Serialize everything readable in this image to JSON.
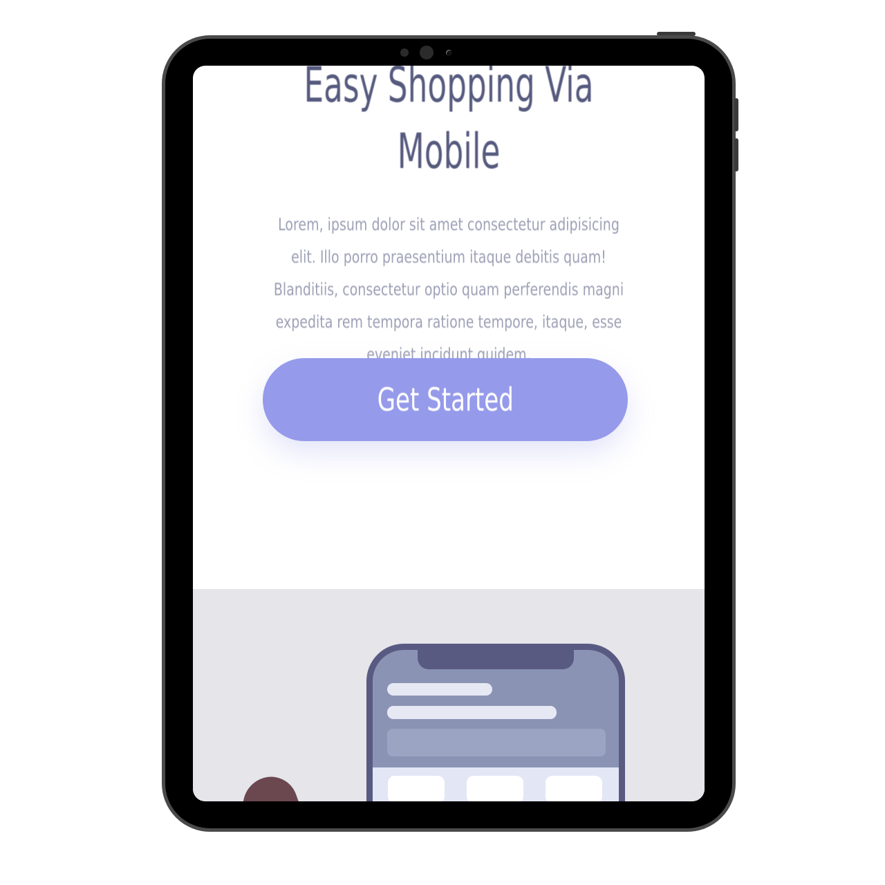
{
  "hero": {
    "title_line1": "Easy Shopping Via",
    "title_line2": "Mobile",
    "description": "Lorem, ipsum dolor sit amet consectetur adipisicing elit. Illo porro praesentium itaque debitis quam! Blanditiis, consectetur optio quam perferendis magni expedita rem tempora ratione tempore, itaque, esse eveniet incidunt quidem.",
    "cta_label": "Get Started"
  },
  "colors": {
    "title": "#565a7e",
    "body_text": "#9ea0b6",
    "accent": "#959aea",
    "illustration_bg": "#e5e5ea",
    "phone_frame": "#585a82"
  },
  "icons": {
    "phone_illustration": "smartphone-illustration",
    "hand_illustration": "hand-illustration"
  }
}
